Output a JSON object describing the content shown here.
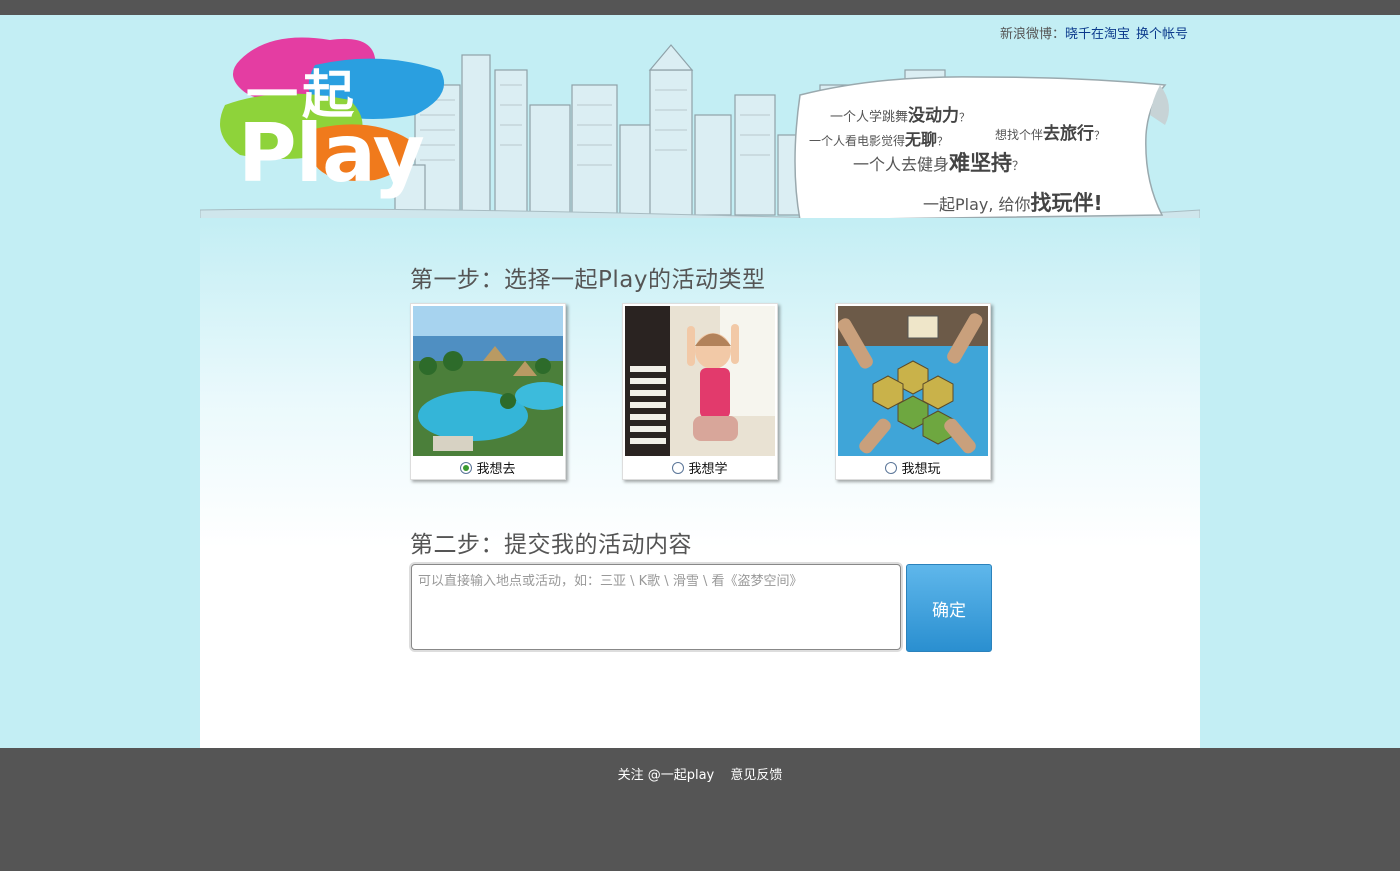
{
  "user": {
    "prefix": "新浪微博：",
    "name": "晓千在淘宝",
    "switch": "换个帐号"
  },
  "logo": {
    "line1": "一起",
    "line2": "Play"
  },
  "slogans": {
    "l1a": "一个人学跳舞",
    "l1b": "没动力",
    "l1c": "？",
    "l2a": "一个人看电影觉得",
    "l2b": "无聊",
    "l2c": "？",
    "l2d": "想找个伴",
    "l2e": "去旅行",
    "l2f": "？",
    "l3a": "一个人去健身",
    "l3b": "难坚持",
    "l3c": "？",
    "l4a": "一起Play, 给你",
    "l4b": "找玩伴",
    "l4c": "!"
  },
  "step1": {
    "title": "第一步：选择一起Play的活动类型",
    "options": [
      {
        "label": "我想去",
        "selected": true
      },
      {
        "label": "我想学",
        "selected": false
      },
      {
        "label": "我想玩",
        "selected": false
      }
    ]
  },
  "step2": {
    "title": "第二步：提交我的活动内容",
    "placeholder": "可以直接输入地点或活动，如：三亚 \\ K歌 \\ 滑雪 \\ 看《盗梦空间》",
    "submit": "确定"
  },
  "footer": {
    "follow": "关注 @一起play",
    "feedback": "意见反馈"
  },
  "colors": {
    "page_bg": "#c3eef4",
    "bar_bg": "#555555",
    "button": "#2a8fd0",
    "link": "#0b3a8c"
  }
}
